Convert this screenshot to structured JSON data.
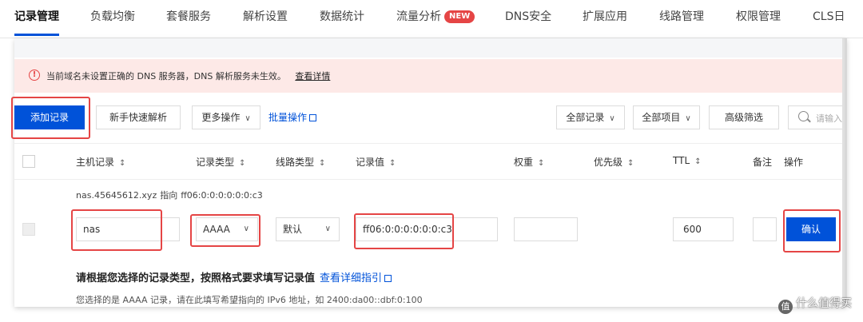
{
  "tabs": [
    {
      "label": "记录管理",
      "active": true
    },
    {
      "label": "负载均衡"
    },
    {
      "label": "套餐服务"
    },
    {
      "label": "解析设置"
    },
    {
      "label": "数据统计"
    },
    {
      "label": "流量分析",
      "badge": "NEW"
    },
    {
      "label": "DNS安全"
    },
    {
      "label": "扩展应用"
    },
    {
      "label": "线路管理"
    },
    {
      "label": "权限管理"
    },
    {
      "label": "CLS日"
    }
  ],
  "alert": {
    "icon": "warning-circle-icon",
    "text": "当前域名未设置正确的 DNS 服务器，DNS 解析服务未生效。",
    "link": "查看详情",
    "color": "#e54545"
  },
  "toolbar": {
    "add_record": "添加记录",
    "quick_resolve": "新手快速解析",
    "more_actions": "更多操作",
    "batch_ops": "批量操作",
    "all_records": "全部记录",
    "all_items": "全部项目",
    "advanced_filter": "高级筛选",
    "search_placeholder": "请输入"
  },
  "table": {
    "columns": [
      "主机记录",
      "记录类型",
      "线路类型",
      "记录值",
      "权重",
      "优先级",
      "TTL",
      "备注",
      "操作"
    ]
  },
  "hint": {
    "host": "nas.45645612.xyz",
    "arrow_word": "指向",
    "value": "ff06:0:0:0:0:0:0:c3"
  },
  "edit_row": {
    "host": "nas",
    "type": "AAAA",
    "line": "默认",
    "value": "ff06:0:0:0:0:0:0:c3",
    "ttl": "600",
    "confirm": "确认"
  },
  "tips": {
    "main": "请根据您选择的记录类型，按照格式要求填写记录值",
    "guide_link": "查看详细指引",
    "detail": "您选择的是 AAAA 记录，请在此填写希望指向的 IPv6 地址，如 2400:da00::dbf:0:100"
  },
  "watermark": {
    "logo": "值",
    "text": "什么值得买"
  },
  "colors": {
    "accent": "#0052d9",
    "highlight": "#e54545"
  }
}
